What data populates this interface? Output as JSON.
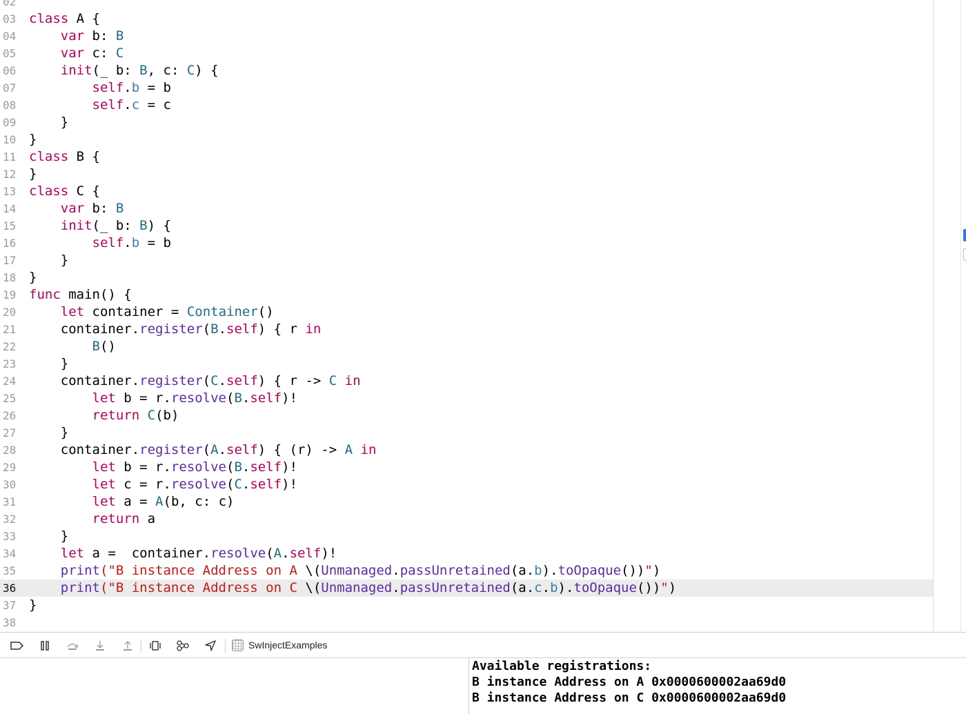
{
  "editor": {
    "current_line": "36",
    "lines": [
      {
        "num": "02",
        "tokens": []
      },
      {
        "num": "03",
        "tokens": [
          {
            "t": "class",
            "c": "kw"
          },
          {
            "t": " A {",
            "c": "plain"
          }
        ]
      },
      {
        "num": "04",
        "tokens": [
          {
            "t": "    ",
            "c": "plain"
          },
          {
            "t": "var",
            "c": "kw"
          },
          {
            "t": " b: ",
            "c": "plain"
          },
          {
            "t": "B",
            "c": "type"
          }
        ]
      },
      {
        "num": "05",
        "tokens": [
          {
            "t": "    ",
            "c": "plain"
          },
          {
            "t": "var",
            "c": "kw"
          },
          {
            "t": " c: ",
            "c": "plain"
          },
          {
            "t": "C",
            "c": "type"
          }
        ]
      },
      {
        "num": "06",
        "tokens": [
          {
            "t": "    ",
            "c": "plain"
          },
          {
            "t": "init",
            "c": "kw"
          },
          {
            "t": "(_ b: ",
            "c": "plain"
          },
          {
            "t": "B",
            "c": "type"
          },
          {
            "t": ", c: ",
            "c": "plain"
          },
          {
            "t": "C",
            "c": "type"
          },
          {
            "t": ") {",
            "c": "plain"
          }
        ]
      },
      {
        "num": "07",
        "tokens": [
          {
            "t": "        ",
            "c": "plain"
          },
          {
            "t": "self",
            "c": "kw"
          },
          {
            "t": ".",
            "c": "plain"
          },
          {
            "t": "b",
            "c": "prop"
          },
          {
            "t": " = b",
            "c": "plain"
          }
        ]
      },
      {
        "num": "08",
        "tokens": [
          {
            "t": "        ",
            "c": "plain"
          },
          {
            "t": "self",
            "c": "kw"
          },
          {
            "t": ".",
            "c": "plain"
          },
          {
            "t": "c",
            "c": "prop"
          },
          {
            "t": " = c",
            "c": "plain"
          }
        ]
      },
      {
        "num": "09",
        "tokens": [
          {
            "t": "    }",
            "c": "plain"
          }
        ]
      },
      {
        "num": "10",
        "tokens": [
          {
            "t": "}",
            "c": "plain"
          }
        ]
      },
      {
        "num": "11",
        "tokens": [
          {
            "t": "class",
            "c": "kw"
          },
          {
            "t": " B {",
            "c": "plain"
          }
        ]
      },
      {
        "num": "12",
        "tokens": [
          {
            "t": "}",
            "c": "plain"
          }
        ]
      },
      {
        "num": "13",
        "tokens": [
          {
            "t": "class",
            "c": "kw"
          },
          {
            "t": " C {",
            "c": "plain"
          }
        ]
      },
      {
        "num": "14",
        "tokens": [
          {
            "t": "    ",
            "c": "plain"
          },
          {
            "t": "var",
            "c": "kw"
          },
          {
            "t": " b: ",
            "c": "plain"
          },
          {
            "t": "B",
            "c": "type"
          }
        ]
      },
      {
        "num": "15",
        "tokens": [
          {
            "t": "    ",
            "c": "plain"
          },
          {
            "t": "init",
            "c": "kw"
          },
          {
            "t": "(_ b: ",
            "c": "plain"
          },
          {
            "t": "B",
            "c": "type"
          },
          {
            "t": ") {",
            "c": "plain"
          }
        ]
      },
      {
        "num": "16",
        "tokens": [
          {
            "t": "        ",
            "c": "plain"
          },
          {
            "t": "self",
            "c": "kw"
          },
          {
            "t": ".",
            "c": "plain"
          },
          {
            "t": "b",
            "c": "prop"
          },
          {
            "t": " = b",
            "c": "plain"
          }
        ]
      },
      {
        "num": "17",
        "tokens": [
          {
            "t": "    }",
            "c": "plain"
          }
        ]
      },
      {
        "num": "18",
        "tokens": [
          {
            "t": "}",
            "c": "plain"
          }
        ]
      },
      {
        "num": "19",
        "tokens": [
          {
            "t": "func",
            "c": "kw"
          },
          {
            "t": " main() {",
            "c": "plain"
          }
        ]
      },
      {
        "num": "20",
        "tokens": [
          {
            "t": "    ",
            "c": "plain"
          },
          {
            "t": "let",
            "c": "kw"
          },
          {
            "t": " container = ",
            "c": "plain"
          },
          {
            "t": "Container",
            "c": "type"
          },
          {
            "t": "()",
            "c": "plain"
          }
        ]
      },
      {
        "num": "21",
        "tokens": [
          {
            "t": "    container.",
            "c": "plain"
          },
          {
            "t": "register",
            "c": "fn"
          },
          {
            "t": "(",
            "c": "plain"
          },
          {
            "t": "B",
            "c": "type"
          },
          {
            "t": ".",
            "c": "plain"
          },
          {
            "t": "self",
            "c": "kw"
          },
          {
            "t": ") { r ",
            "c": "plain"
          },
          {
            "t": "in",
            "c": "kw"
          }
        ]
      },
      {
        "num": "22",
        "tokens": [
          {
            "t": "        ",
            "c": "plain"
          },
          {
            "t": "B",
            "c": "type"
          },
          {
            "t": "()",
            "c": "plain"
          }
        ]
      },
      {
        "num": "23",
        "tokens": [
          {
            "t": "    }",
            "c": "plain"
          }
        ]
      },
      {
        "num": "24",
        "tokens": [
          {
            "t": "    container.",
            "c": "plain"
          },
          {
            "t": "register",
            "c": "fn"
          },
          {
            "t": "(",
            "c": "plain"
          },
          {
            "t": "C",
            "c": "type"
          },
          {
            "t": ".",
            "c": "plain"
          },
          {
            "t": "self",
            "c": "kw"
          },
          {
            "t": ") { r -> ",
            "c": "plain"
          },
          {
            "t": "C",
            "c": "type"
          },
          {
            "t": " ",
            "c": "plain"
          },
          {
            "t": "in",
            "c": "kw"
          }
        ]
      },
      {
        "num": "25",
        "tokens": [
          {
            "t": "        ",
            "c": "plain"
          },
          {
            "t": "let",
            "c": "kw"
          },
          {
            "t": " b = r.",
            "c": "plain"
          },
          {
            "t": "resolve",
            "c": "fn"
          },
          {
            "t": "(",
            "c": "plain"
          },
          {
            "t": "B",
            "c": "type"
          },
          {
            "t": ".",
            "c": "plain"
          },
          {
            "t": "self",
            "c": "kw"
          },
          {
            "t": ")!",
            "c": "plain"
          }
        ]
      },
      {
        "num": "26",
        "tokens": [
          {
            "t": "        ",
            "c": "plain"
          },
          {
            "t": "return",
            "c": "kw"
          },
          {
            "t": " ",
            "c": "plain"
          },
          {
            "t": "C",
            "c": "type"
          },
          {
            "t": "(b)",
            "c": "plain"
          }
        ]
      },
      {
        "num": "27",
        "tokens": [
          {
            "t": "    }",
            "c": "plain"
          }
        ]
      },
      {
        "num": "28",
        "tokens": [
          {
            "t": "    container.",
            "c": "plain"
          },
          {
            "t": "register",
            "c": "fn"
          },
          {
            "t": "(",
            "c": "plain"
          },
          {
            "t": "A",
            "c": "type"
          },
          {
            "t": ".",
            "c": "plain"
          },
          {
            "t": "self",
            "c": "kw"
          },
          {
            "t": ") { (r) -> ",
            "c": "plain"
          },
          {
            "t": "A",
            "c": "type"
          },
          {
            "t": " ",
            "c": "plain"
          },
          {
            "t": "in",
            "c": "kw"
          }
        ]
      },
      {
        "num": "29",
        "tokens": [
          {
            "t": "        ",
            "c": "plain"
          },
          {
            "t": "let",
            "c": "kw"
          },
          {
            "t": " b = r.",
            "c": "plain"
          },
          {
            "t": "resolve",
            "c": "fn"
          },
          {
            "t": "(",
            "c": "plain"
          },
          {
            "t": "B",
            "c": "type"
          },
          {
            "t": ".",
            "c": "plain"
          },
          {
            "t": "self",
            "c": "kw"
          },
          {
            "t": ")!",
            "c": "plain"
          }
        ]
      },
      {
        "num": "30",
        "tokens": [
          {
            "t": "        ",
            "c": "plain"
          },
          {
            "t": "let",
            "c": "kw"
          },
          {
            "t": " c = r.",
            "c": "plain"
          },
          {
            "t": "resolve",
            "c": "fn"
          },
          {
            "t": "(",
            "c": "plain"
          },
          {
            "t": "C",
            "c": "type"
          },
          {
            "t": ".",
            "c": "plain"
          },
          {
            "t": "self",
            "c": "kw"
          },
          {
            "t": ")!",
            "c": "plain"
          }
        ]
      },
      {
        "num": "31",
        "tokens": [
          {
            "t": "        ",
            "c": "plain"
          },
          {
            "t": "let",
            "c": "kw"
          },
          {
            "t": " a = ",
            "c": "plain"
          },
          {
            "t": "A",
            "c": "type"
          },
          {
            "t": "(b, c: c)",
            "c": "plain"
          }
        ]
      },
      {
        "num": "32",
        "tokens": [
          {
            "t": "        ",
            "c": "plain"
          },
          {
            "t": "return",
            "c": "kw"
          },
          {
            "t": " a",
            "c": "plain"
          }
        ]
      },
      {
        "num": "33",
        "tokens": [
          {
            "t": "    }",
            "c": "plain"
          }
        ]
      },
      {
        "num": "34",
        "tokens": [
          {
            "t": "    ",
            "c": "plain"
          },
          {
            "t": "let",
            "c": "kw"
          },
          {
            "t": " a =  container.",
            "c": "plain"
          },
          {
            "t": "resolve",
            "c": "fn"
          },
          {
            "t": "(",
            "c": "plain"
          },
          {
            "t": "A",
            "c": "type"
          },
          {
            "t": ".",
            "c": "plain"
          },
          {
            "t": "self",
            "c": "kw"
          },
          {
            "t": ")!",
            "c": "plain"
          }
        ]
      },
      {
        "num": "35",
        "tokens": [
          {
            "t": "    ",
            "c": "plain"
          },
          {
            "t": "print",
            "c": "fn"
          },
          {
            "t": "(\"B instance Address on A ",
            "c": "str"
          },
          {
            "t": "\\(",
            "c": "plain"
          },
          {
            "t": "Unmanaged",
            "c": "fn"
          },
          {
            "t": ".",
            "c": "plain"
          },
          {
            "t": "passUnretained",
            "c": "fn"
          },
          {
            "t": "(a.",
            "c": "plain"
          },
          {
            "t": "b",
            "c": "prop"
          },
          {
            "t": ").",
            "c": "plain"
          },
          {
            "t": "toOpaque",
            "c": "fn"
          },
          {
            "t": "())",
            "c": "plain"
          },
          {
            "t": "\"",
            "c": "str"
          },
          {
            "t": ")",
            "c": "plain"
          }
        ]
      },
      {
        "num": "36",
        "tokens": [
          {
            "t": "    ",
            "c": "plain"
          },
          {
            "t": "print",
            "c": "fn"
          },
          {
            "t": "(\"B instance Address on C ",
            "c": "str"
          },
          {
            "t": "\\(",
            "c": "plain"
          },
          {
            "t": "Unmanaged",
            "c": "fn"
          },
          {
            "t": ".",
            "c": "plain"
          },
          {
            "t": "passUnretained",
            "c": "fn"
          },
          {
            "t": "(a.",
            "c": "plain"
          },
          {
            "t": "c",
            "c": "prop"
          },
          {
            "t": ".",
            "c": "plain"
          },
          {
            "t": "b",
            "c": "prop"
          },
          {
            "t": ").",
            "c": "plain"
          },
          {
            "t": "toOpaque",
            "c": "fn"
          },
          {
            "t": "())",
            "c": "plain"
          },
          {
            "t": "\"",
            "c": "str"
          },
          {
            "t": ")",
            "c": "plain"
          }
        ]
      },
      {
        "num": "37",
        "tokens": [
          {
            "t": "}",
            "c": "plain"
          }
        ]
      },
      {
        "num": "38",
        "tokens": []
      }
    ]
  },
  "debug_bar": {
    "buttons": [
      {
        "name": "toggle-console-icon",
        "glyph": "▭"
      },
      {
        "name": "pause-icon",
        "glyph": "❚❚"
      },
      {
        "name": "step-over-icon",
        "glyph": "⤼"
      },
      {
        "name": "step-into-icon",
        "glyph": "⤓"
      },
      {
        "name": "step-out-icon",
        "glyph": "⤒"
      },
      {
        "name": "view-hierarchy-icon",
        "glyph": "◫"
      },
      {
        "name": "memory-graph-icon",
        "glyph": "⚯"
      },
      {
        "name": "location-icon",
        "glyph": "➤"
      }
    ],
    "target_name": "SwInjectExamples"
  },
  "console": {
    "lines": [
      "Available registrations:",
      "B instance Address on A 0x0000600002aa69d0",
      "B instance Address on C 0x0000600002aa69d0"
    ]
  },
  "colors": {
    "keyword": "#b5005e",
    "type": "#1d6e83",
    "string": "#c41a16",
    "function": "#5b2aa6",
    "current_line_bg": "#ececec"
  }
}
